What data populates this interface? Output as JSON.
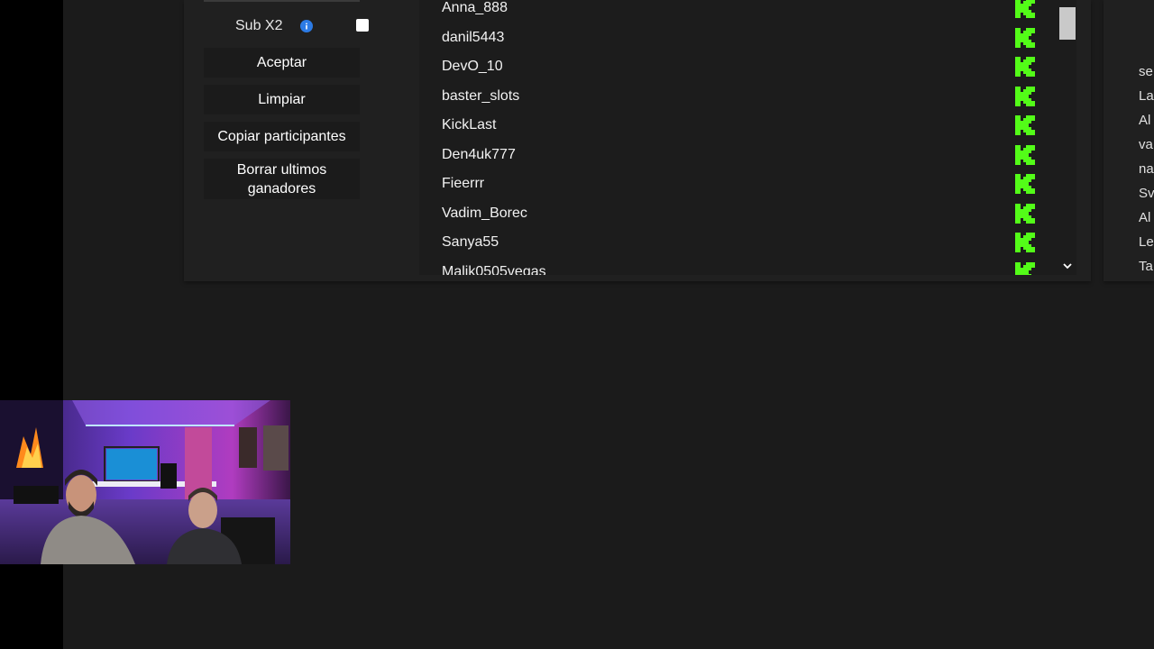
{
  "controls": {
    "sub_x2_label": "Sub X2",
    "accept_label": "Aceptar",
    "clear_label": "Limpiar",
    "copy_label": "Copiar participantes",
    "delete_winners_label": "Borrar ultimos ganadores"
  },
  "participants": [
    {
      "name": "Anna_888",
      "icon": "kick-icon"
    },
    {
      "name": "danil5443",
      "icon": "kick-icon"
    },
    {
      "name": "DevO_10",
      "icon": "kick-icon"
    },
    {
      "name": "baster_slots",
      "icon": "kick-icon"
    },
    {
      "name": "KickLast",
      "icon": "kick-icon"
    },
    {
      "name": "Den4uk777",
      "icon": "kick-icon"
    },
    {
      "name": "Fieerrr",
      "icon": "kick-icon"
    },
    {
      "name": "Vadim_Borec",
      "icon": "kick-icon"
    },
    {
      "name": "Sanya55",
      "icon": "kick-icon"
    },
    {
      "name": "Malik0505vegas",
      "icon": "kick-icon"
    }
  ],
  "right_list_fragments": [
    "se",
    "La",
    "Al",
    "va",
    "na",
    "Sv",
    "Al",
    "Le",
    "Ta"
  ],
  "colors": {
    "kick_green": "#53fc18",
    "info_blue": "#2c7be5",
    "panel_bg": "#202020"
  }
}
